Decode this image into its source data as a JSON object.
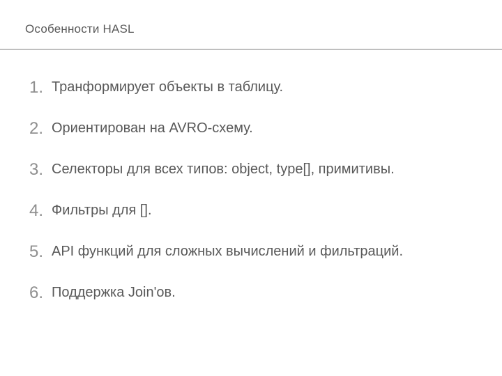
{
  "title": "Особенности HASL",
  "items": [
    "Транформирует объекты в таблицу.",
    "Ориентирован на AVRO-схему.",
    "Селекторы для всех типов: object, type[], примитивы.",
    "Фильтры для [].",
    "API функций для сложных вычислений и фильтраций.",
    "Поддержка Join'ов."
  ]
}
